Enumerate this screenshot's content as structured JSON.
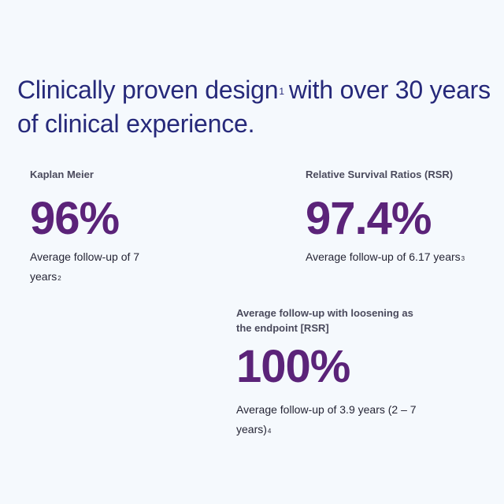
{
  "headline": {
    "part1": "Clinically proven design",
    "sup": "1",
    "part2": "with over 30 years of clinical experience."
  },
  "stats": {
    "kaplan_meier": {
      "label": "Kaplan Meier",
      "value": "96%",
      "note_text": "Average follow-up of 7 years",
      "note_sup": "2"
    },
    "rsr": {
      "label": "Relative Survival Ratios (RSR)",
      "value": "97.4%",
      "note_text": "Average follow-up of 6.17 years",
      "note_sup": "3"
    },
    "loosening": {
      "label": "Average follow-up with loosening as the endpoint [RSR]",
      "value": "100%",
      "note_text": "Average follow-up of 3.9 years (2 – 7 years)",
      "note_sup": "4"
    }
  },
  "colors": {
    "headline": "#26297a",
    "stat_value": "#5b2379",
    "label": "#4a4a5c",
    "background": "#f5f9fd"
  }
}
